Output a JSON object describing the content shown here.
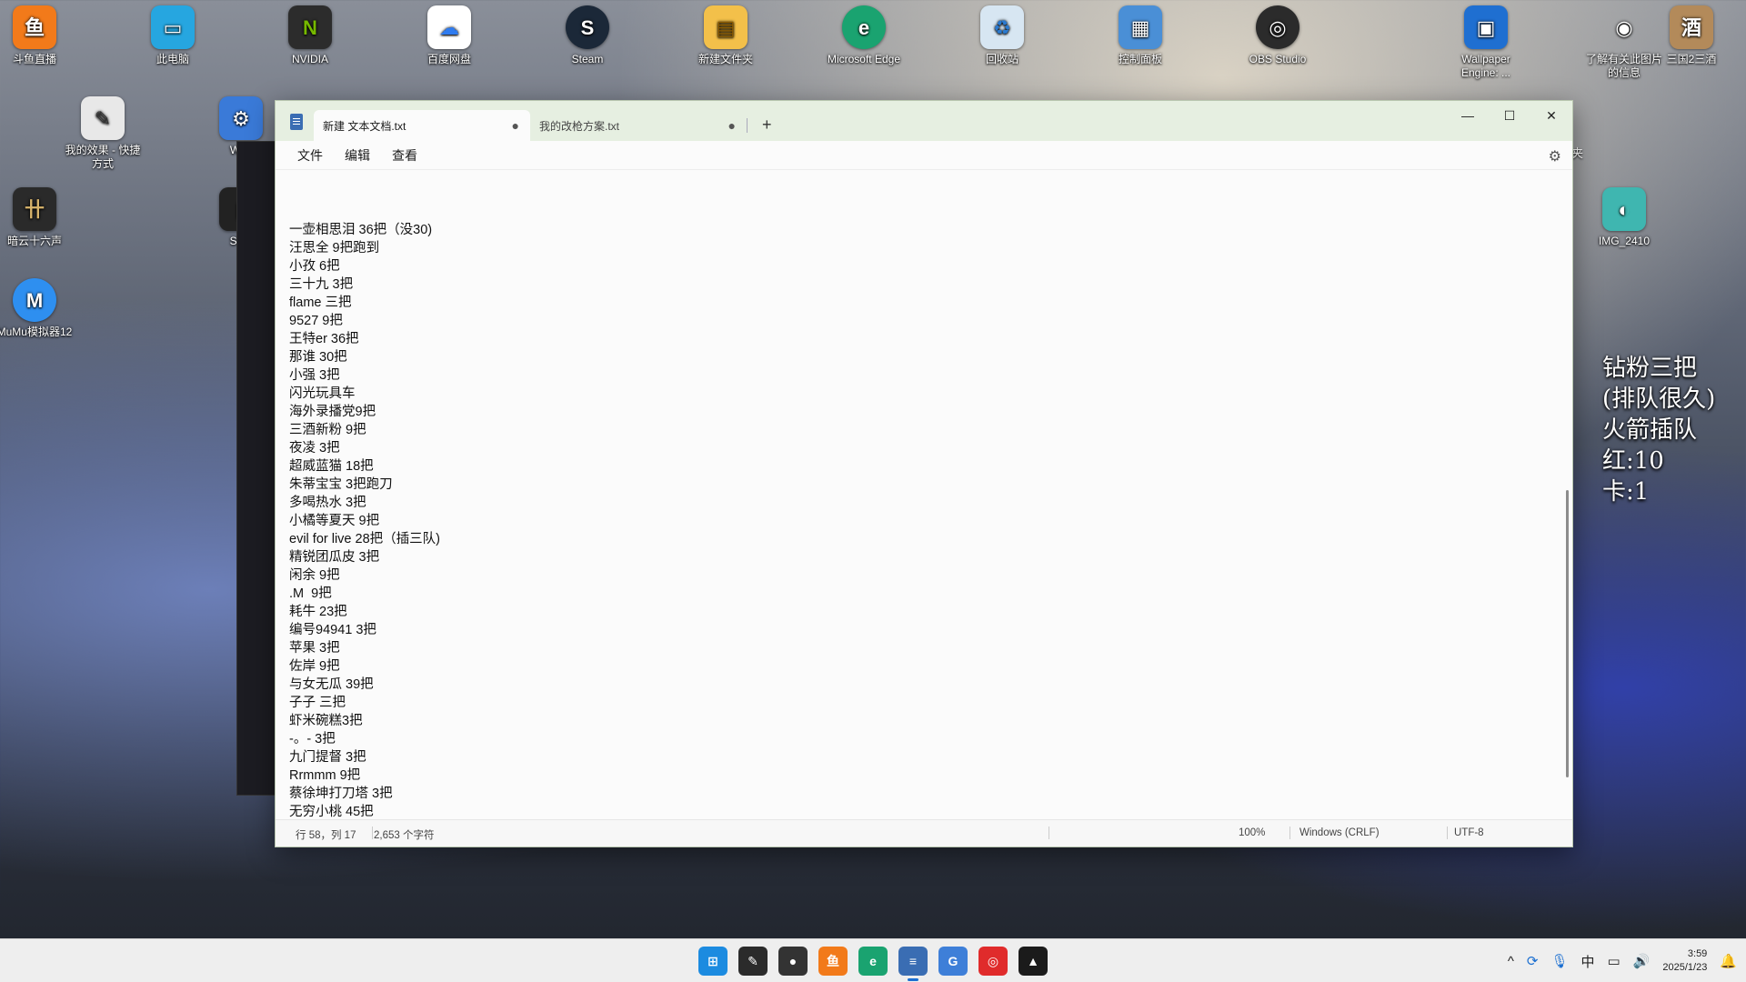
{
  "desktop": {
    "icons": [
      {
        "label": "斗鱼直播",
        "glyph": "鱼",
        "color": "#f27a1a"
      },
      {
        "label": "此电脑",
        "glyph": "▭",
        "color": "#26a6e0"
      },
      {
        "label": "NVIDIA",
        "glyph": "N",
        "color": "#2c2c2c"
      },
      {
        "label": "百度网盘",
        "glyph": "☁",
        "color": "#ffffff"
      },
      {
        "label": "Steam",
        "glyph": "S",
        "color": "#1b2838"
      },
      {
        "label": "新建文件夹",
        "glyph": "▤",
        "color": "#f3c04a"
      },
      {
        "label": "Microsoft Edge",
        "glyph": "e",
        "color": "#1aa370"
      },
      {
        "label": "回收站",
        "glyph": "♻",
        "color": "#d7e6f2"
      },
      {
        "label": "控制面板",
        "glyph": "▦",
        "color": "#4a8fd6"
      },
      {
        "label": "OBS Studio",
        "glyph": "◎",
        "color": "#2b2b2b"
      },
      {
        "label": "Wallpaper Engine: ...",
        "glyph": "▣",
        "color": "#1f6fd1"
      },
      {
        "label": "了解有关此图片的信息",
        "glyph": "◉",
        "color": "#7c7c7c"
      },
      {
        "label": "三国2三酒",
        "glyph": "酒",
        "color": "#b38a5a"
      },
      {
        "label": "我的效果 - 快捷方式",
        "glyph": "✎",
        "color": "#e8e8e8"
      },
      {
        "label": "Watt",
        "glyph": "⚙",
        "color": "#3a7ad8"
      },
      {
        "label": "暗云十六声",
        "glyph": "卄",
        "color": "#2a2a2a"
      },
      {
        "label": "Stud",
        "glyph": "▮",
        "color": "#222222"
      },
      {
        "label": "MuMu模拟器12",
        "glyph": "M",
        "color": "#2e8ff0"
      },
      {
        "label": "IMG_2410",
        "glyph": "◐",
        "color": "#3fb6b0"
      }
    ],
    "overlay_lines": [
      "钻粉三把",
      "(排队很久)",
      "火箭插队",
      "红:10",
      "卡:1"
    ],
    "stray_char": "夹"
  },
  "notepad": {
    "tabs": [
      {
        "label": "新建 文本文档.txt",
        "modified_mark": "●"
      },
      {
        "label": "我的改枪方案.txt",
        "modified_mark": "●"
      }
    ],
    "new_tab": "+",
    "window_controls": {
      "minimize": "—",
      "maximize": "☐",
      "close": "✕"
    },
    "menu": {
      "file": "文件",
      "edit": "编辑",
      "view": "查看"
    },
    "lines": [
      "一壶相思泪 36把（没30)",
      "汪思全 9把跑到",
      "小孜 6把",
      "三十九 3把",
      "flame 三把",
      "9527 9把",
      "王特er 36把",
      "那谁 30把",
      "小强 3把",
      "闪光玩具车",
      "海外录播党9把",
      "三酒新粉 9把",
      "夜凌 3把",
      "超威蓝猫 18把",
      "朱蒂宝宝 3把跑刀",
      "多喝热水 3把",
      "小橘等夏天 9把",
      "evil for live 28把（插三队)",
      "精锐团瓜皮 3把",
      "闲余 9把",
      ".M  9把",
      "耗牛 23把",
      "编号94941 3把",
      "苹果 3把",
      "佐岸 9把",
      "与女无瓜 39把",
      "子子 三把",
      "虾米碗糕3把",
      "-。- 3把",
      "九门提督 3把",
      "Rrmmm 9把",
      "蔡徐坤打刀塔 3把",
      "无穷小桃 45把"
    ],
    "status": {
      "position": "行 58，列 17",
      "chars": "2,653 个字符",
      "zoom": "100%",
      "line_ending": "Windows (CRLF)",
      "encoding": "UTF-8"
    }
  },
  "taskbar": {
    "apps": [
      {
        "name": "start",
        "glyph": "⊞",
        "color": "#1c8be0"
      },
      {
        "name": "app-1",
        "glyph": "✎",
        "color": "#2b2b2b"
      },
      {
        "name": "app-2",
        "glyph": "●",
        "color": "#333333"
      },
      {
        "name": "douyu",
        "glyph": "鱼",
        "color": "#f27a1a"
      },
      {
        "name": "edge",
        "glyph": "e",
        "color": "#1aa370"
      },
      {
        "name": "notepad",
        "glyph": "≡",
        "color": "#3a6db3"
      },
      {
        "name": "app-g",
        "glyph": "G",
        "color": "#3e7fd8"
      },
      {
        "name": "netease-music",
        "glyph": "◎",
        "color": "#e02b2b"
      },
      {
        "name": "app-a",
        "glyph": "▲",
        "color": "#1b1b1b"
      }
    ],
    "tray": {
      "chevron": "^",
      "ime": "中",
      "time": "3:59",
      "date": "2025/1/23"
    }
  }
}
